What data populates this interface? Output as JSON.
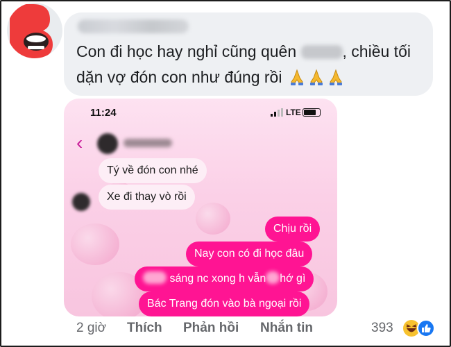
{
  "comment": {
    "line1": "Con đi học hay nghỉ cũng quên",
    "line1b": ", chiều tối",
    "line2": "dặn vợ đón con như đúng rồi"
  },
  "phone": {
    "time": "11:24",
    "network": "LTE",
    "messages_in": [
      "Tý về đón con nhé",
      "Xe đi thay vò rồi"
    ],
    "messages_out": [
      "Chịu rồi",
      "Nay con có đi học đâu",
      "sáng nc xong h vẫn",
      "hớ gì",
      "Bác Trang đón vào bà ngoại rồi"
    ]
  },
  "footer": {
    "time": "2 giờ",
    "like": "Thích",
    "reply": "Phản hồi",
    "message": "Nhắn tin",
    "reaction_count": "393"
  },
  "colors": {
    "accent_pink": "#ff1493",
    "bubble_bg": "#eef0f3",
    "logo_red": "#ee3b3b",
    "like_blue": "#1877f2"
  },
  "icons": [
    "logo-icon",
    "folded-hands-icon",
    "back-chevron-icon",
    "signal-icon",
    "battery-icon",
    "laugh-reaction-icon",
    "like-reaction-icon"
  ]
}
